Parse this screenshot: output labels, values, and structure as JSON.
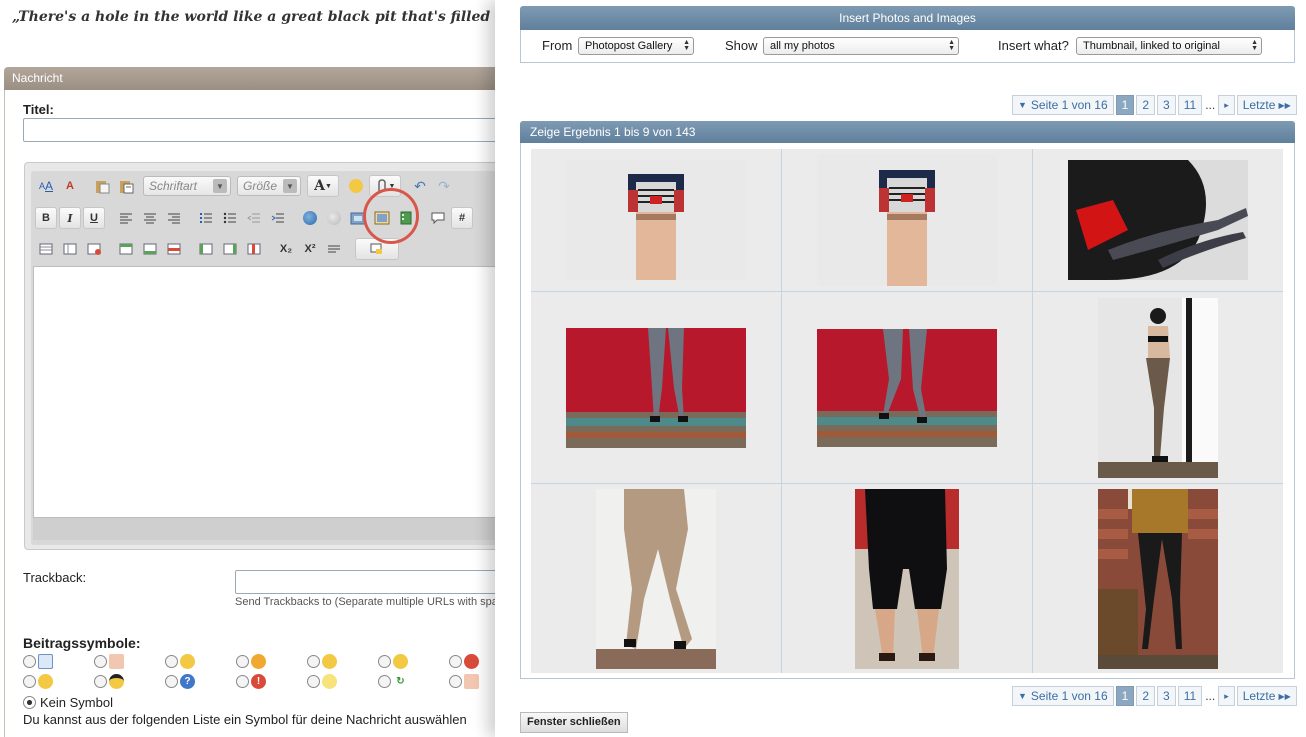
{
  "editor_page": {
    "quote": "„There's a hole in the world like a great black pit that's filled with people",
    "section_title": "Nachricht",
    "titel_label": "Titel:",
    "font_select": "Schriftart",
    "size_select": "Größe",
    "toolbar_labels": {
      "bold": "B",
      "italic": "I",
      "underline": "U",
      "font_color": "A",
      "hash": "#",
      "subscript": "X₂",
      "superscript": "X²"
    },
    "trackback_label": "Trackback:",
    "trackback_hint": "Send Trackbacks to (Separate multiple URLs with spa",
    "beitragssymbole_label": "Beitragssymbole:",
    "kein_symbol": "Kein Symbol",
    "symbol_hint": "Du kannst aus der folgenden Liste ein Symbol für deine Nachricht auswählen"
  },
  "popup": {
    "title": "Insert Photos and Images",
    "from_label": "From",
    "from_value": "Photopost Gallery",
    "show_label": "Show",
    "show_value": "all my photos",
    "insert_label": "Insert what?",
    "insert_value": "Thumbnail, linked to original",
    "pager": {
      "page_text": "Seite 1 von 16",
      "pages": [
        "1",
        "2",
        "3",
        "11"
      ],
      "current": "1",
      "ellipsis": "...",
      "next": "▸",
      "last": "Letzte"
    },
    "results_header": "Zeige Ergebnis 1 bis 9 von 143",
    "close_button": "Fenster schließen"
  },
  "colors": {
    "panel_header": "#6f8ca8",
    "editor_header": "#a89c91",
    "highlight_ring": "#d9574a",
    "pager_current": "#8ba7c2"
  }
}
